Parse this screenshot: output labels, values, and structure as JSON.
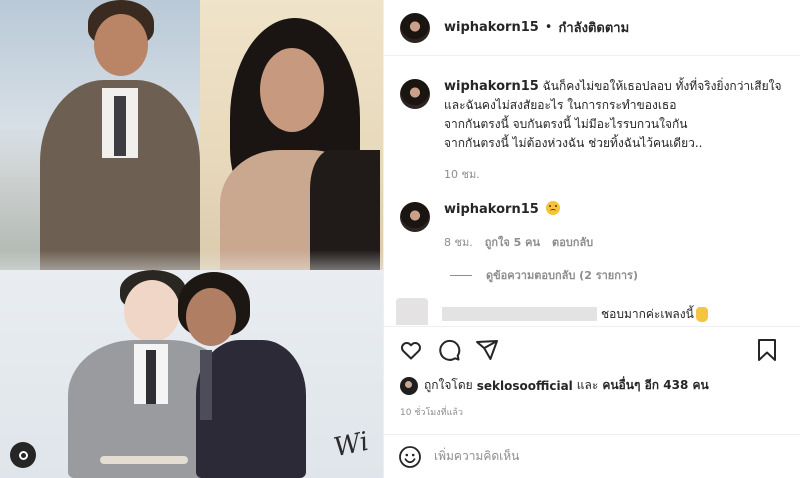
{
  "post": {
    "username": "wiphakorn15",
    "separator": "•",
    "follow_label": "กำลังติดตาม"
  },
  "caption": {
    "username": "wiphakorn15",
    "lines": [
      "ฉันก็คงไม่ขอให้เธอปลอบ ทั้งที่จริงยิ่งกว่าเสียใจ",
      "และฉันคงไม่สงสัยอะไร ในการกระทำของเธอ",
      "จากกันตรงนี้ จบกันตรงนี้  ไม่มีอะไรรบกวนใจกัน",
      "จากกันตรงนี้ ไม่ต้องห่วงฉัน ช่วยทิ้งฉันไว้คนเดียว.."
    ],
    "time": "10 ชม."
  },
  "comment1": {
    "username": "wiphakorn15",
    "time": "8 ชม.",
    "likes": "ถูกใจ 5 คน",
    "reply_label": "ตอบกลับ",
    "view_replies": "ดูข้อความตอบกลับ (2 รายการ)"
  },
  "comment2": {
    "text": "ชอบมากค่ะเพลงนี้"
  },
  "likes": {
    "prefix": "ถูกใจโดย",
    "user": "seklosoofficial",
    "and": "และ",
    "others": "คนอื่นๆ อีก 438 คน"
  },
  "timeago": "10 ชั่วโมงที่แล้ว",
  "add_comment": {
    "placeholder": "เพิ่มความคิดเห็น"
  },
  "media": {
    "signature": "Wi"
  }
}
